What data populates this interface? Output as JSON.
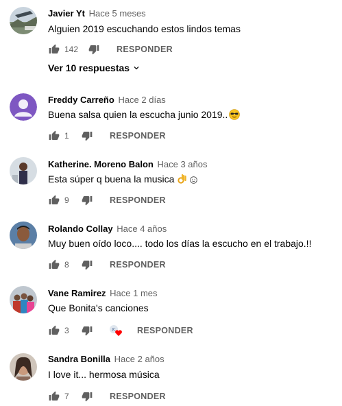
{
  "comments": [
    {
      "author": "Javier Yt",
      "time": "Hace 5 meses",
      "text": "Alguien 2019 escuchando estos lindos temas",
      "likes": "142",
      "reply_label": "RESPONDER",
      "view_replies": "Ver 10 respuestas",
      "avatar_icon": "avatar-landscape-photo"
    },
    {
      "author": "Freddy Carreño",
      "time": "Hace 2 días",
      "text": "Buena salsa quien la escucha junio 2019..",
      "likes": "1",
      "reply_label": "RESPONDER",
      "avatar_icon": "default-user-avatar",
      "emoji": "sunglasses-emoji"
    },
    {
      "author": "Katherine. Moreno Balon",
      "time": "Hace 3 años",
      "text": "Esta súper q buena la musica",
      "likes": "9",
      "reply_label": "RESPONDER",
      "avatar_icon": "avatar-photo",
      "emoji": "ok-hand-emoji"
    },
    {
      "author": "Rolando Collay",
      "time": "Hace 4 años",
      "text": "Muy buen oído loco.... todo los días la escucho en el trabajo.!!",
      "likes": "8",
      "reply_label": "RESPONDER",
      "avatar_icon": "avatar-photo"
    },
    {
      "author": "Vane Ramirez",
      "time": "Hace 1 mes",
      "text": "Que Bonita's canciones",
      "likes": "3",
      "reply_label": "RESPONDER",
      "avatar_icon": "avatar-group-photo",
      "creator_heart": true
    },
    {
      "author": "Sandra Bonilla",
      "time": "Hace 2 años",
      "text": "I love it... hermosa música",
      "likes": "7",
      "reply_label": "RESPONDER",
      "avatar_icon": "avatar-photo"
    }
  ],
  "colors": {
    "text": "#030303",
    "secondary": "#606060",
    "default_avatar": "#7e57c2",
    "heart": "#ff0000"
  }
}
